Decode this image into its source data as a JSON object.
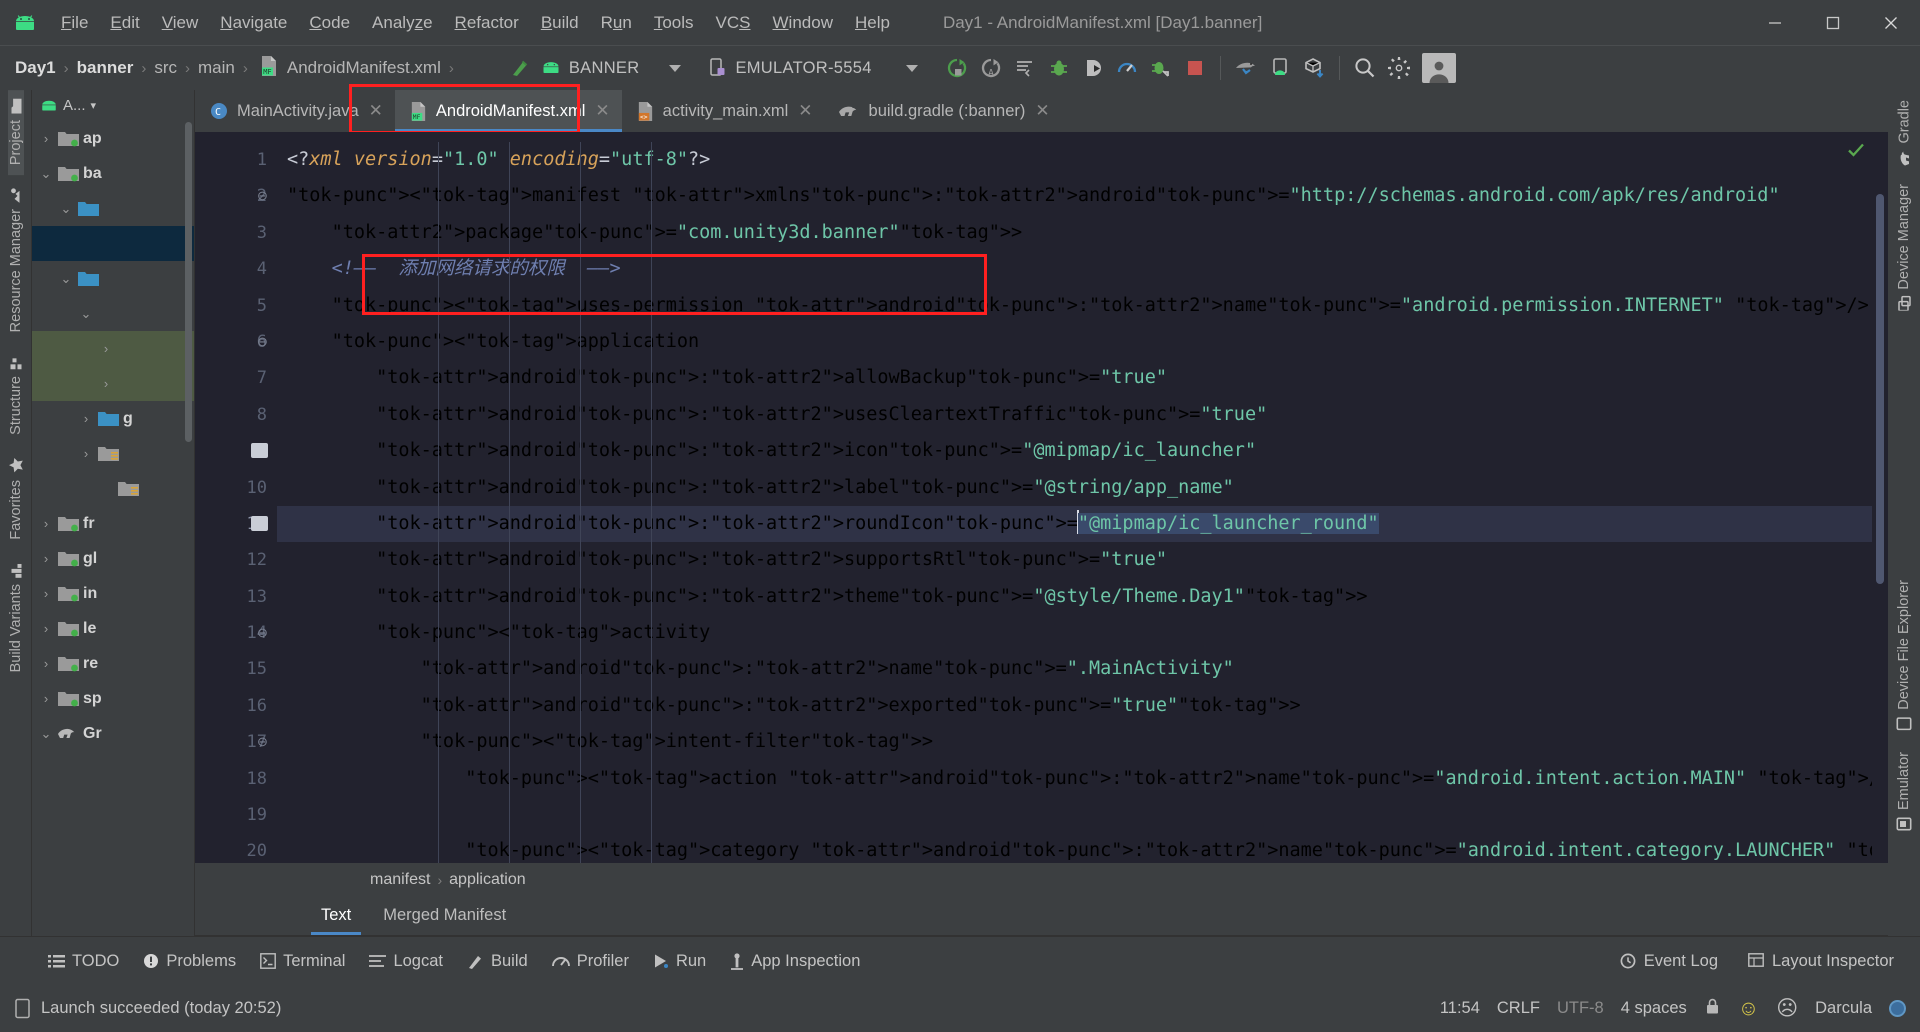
{
  "window": {
    "title": "Day1 - AndroidManifest.xml [Day1.banner]",
    "minimize": "─",
    "maximize": "□",
    "close": "✕"
  },
  "menu": {
    "logo_icon": "android-logo-icon",
    "items": [
      {
        "label": "File",
        "mnemonic": "F"
      },
      {
        "label": "Edit",
        "mnemonic": "E"
      },
      {
        "label": "View",
        "mnemonic": "V"
      },
      {
        "label": "Navigate",
        "mnemonic": "N"
      },
      {
        "label": "Code",
        "mnemonic": "C"
      },
      {
        "label": "Analyze",
        "mnemonic": "z"
      },
      {
        "label": "Refactor",
        "mnemonic": "R"
      },
      {
        "label": "Build",
        "mnemonic": "B"
      },
      {
        "label": "Run",
        "mnemonic": "u"
      },
      {
        "label": "Tools",
        "mnemonic": "T"
      },
      {
        "label": "VCS",
        "mnemonic": "S"
      },
      {
        "label": "Window",
        "mnemonic": "W"
      },
      {
        "label": "Help",
        "mnemonic": "H"
      }
    ]
  },
  "breadcrumb": {
    "items": [
      "Day1",
      "banner",
      "src",
      "main",
      "AndroidManifest.xml"
    ],
    "separator": "›",
    "file_icon": "manifest-file-icon"
  },
  "toolbar": {
    "build_icon": "build-hammer-icon",
    "run_config": {
      "label": "BANNER",
      "icon": "android-config-icon"
    },
    "device": {
      "label": "EMULATOR-5554",
      "icon": "device-phone-icon"
    },
    "actions": [
      {
        "name": "run-button",
        "icon": "run-play-icon"
      },
      {
        "name": "apply-changes-button",
        "icon": "apply-changes-icon"
      },
      {
        "name": "apply-code-changes-button",
        "icon": "apply-code-changes-icon"
      },
      {
        "name": "debug-button",
        "icon": "debug-bug-icon"
      },
      {
        "name": "attach-debugger-button",
        "icon": "attach-debugger-icon"
      },
      {
        "name": "profiler-button",
        "icon": "profiler-icon"
      },
      {
        "name": "run-with-coverage-button",
        "icon": "coverage-icon"
      },
      {
        "name": "stop-button",
        "icon": "stop-square-icon"
      },
      {
        "name": "sync-gradle-button",
        "icon": "gradle-sync-icon"
      },
      {
        "name": "avd-manager-button",
        "icon": "avd-manager-icon"
      },
      {
        "name": "sdk-manager-button",
        "icon": "sdk-manager-icon"
      },
      {
        "name": "search-everywhere-button",
        "icon": "search-icon"
      },
      {
        "name": "settings-button",
        "icon": "gear-icon"
      },
      {
        "name": "account-button",
        "icon": "avatar-icon"
      }
    ]
  },
  "left_strip": [
    {
      "label": "Project",
      "icon": "project-folder-icon",
      "active": true
    },
    {
      "label": "Resource Manager",
      "icon": "resource-manager-icon",
      "active": false
    },
    {
      "label": "Structure",
      "icon": "structure-icon",
      "active": false
    },
    {
      "label": "Favorites",
      "icon": "star-icon",
      "active": false
    },
    {
      "label": "Build Variants",
      "icon": "build-variants-icon",
      "active": false
    }
  ],
  "right_strip": [
    {
      "label": "Gradle",
      "icon": "gradle-elephant-icon"
    },
    {
      "label": "Device Manager",
      "icon": "device-manager-icon"
    },
    {
      "label": "Device File Explorer",
      "icon": "device-file-explorer-icon"
    },
    {
      "label": "Emulator",
      "icon": "emulator-icon"
    }
  ],
  "project_panel": {
    "header": {
      "label": "A...",
      "icon": "android-view-icon",
      "caret": "▾"
    },
    "tree": [
      {
        "arrow": "›",
        "label": "ap",
        "icon": "module-folder-icon",
        "state": "none",
        "indent": 0
      },
      {
        "arrow": "⌄",
        "label": "ba",
        "icon": "module-folder-icon",
        "state": "none",
        "indent": 0
      },
      {
        "arrow": "⌄",
        "label": "",
        "icon": "blue-folder-icon",
        "state": "none",
        "indent": 1
      },
      {
        "arrow": "",
        "label": "",
        "icon": "",
        "state": "blue",
        "indent": 2
      },
      {
        "arrow": "⌄",
        "label": "",
        "icon": "blue-folder-icon",
        "state": "none",
        "indent": 1
      },
      {
        "arrow": "⌄",
        "label": "",
        "icon": "",
        "state": "none",
        "indent": 2
      },
      {
        "arrow": "›",
        "label": "",
        "icon": "",
        "state": "green",
        "indent": 3
      },
      {
        "arrow": "›",
        "label": "",
        "icon": "",
        "state": "green",
        "indent": 3
      },
      {
        "arrow": "›",
        "label": "g",
        "icon": "source-folder-icon",
        "state": "none",
        "indent": 2
      },
      {
        "arrow": "›",
        "label": "",
        "icon": "res-folder-icon",
        "state": "none",
        "indent": 2
      },
      {
        "arrow": "",
        "label": "",
        "icon": "res-folder-icon",
        "state": "none",
        "indent": 3
      },
      {
        "arrow": "›",
        "label": "fr",
        "icon": "module-folder-icon",
        "state": "none",
        "indent": 0
      },
      {
        "arrow": "›",
        "label": "gl",
        "icon": "module-folder-icon",
        "state": "none",
        "indent": 0
      },
      {
        "arrow": "›",
        "label": "in",
        "icon": "module-folder-icon",
        "state": "none",
        "indent": 0
      },
      {
        "arrow": "›",
        "label": "le",
        "icon": "module-folder-icon",
        "state": "none",
        "indent": 0
      },
      {
        "arrow": "›",
        "label": "re",
        "icon": "module-folder-icon",
        "state": "none",
        "indent": 0
      },
      {
        "arrow": "›",
        "label": "sp",
        "icon": "module-folder-icon",
        "state": "none",
        "indent": 0
      },
      {
        "arrow": "⌄",
        "label": "Gr",
        "icon": "gradle-elephant-icon",
        "state": "none",
        "indent": 0
      }
    ]
  },
  "editor_tabs": [
    {
      "label": "MainActivity.java",
      "icon": "java-class-icon",
      "active": false,
      "close": "✕"
    },
    {
      "label": "AndroidManifest.xml",
      "icon": "manifest-file-icon",
      "active": true,
      "close": "✕"
    },
    {
      "label": "activity_main.xml",
      "icon": "layout-xml-icon",
      "active": false,
      "close": "✕"
    },
    {
      "label": "build.gradle (:banner)",
      "icon": "gradle-elephant-icon",
      "active": false,
      "close": "✕"
    }
  ],
  "code": {
    "current_line": 11,
    "lines": [
      {
        "n": 1,
        "mark": false,
        "fold": false
      },
      {
        "n": 2,
        "mark": false,
        "fold": true
      },
      {
        "n": 3,
        "mark": false,
        "fold": false
      },
      {
        "n": 4,
        "mark": false,
        "fold": false
      },
      {
        "n": 5,
        "mark": false,
        "fold": false
      },
      {
        "n": 6,
        "mark": false,
        "fold": true
      },
      {
        "n": 7,
        "mark": false,
        "fold": false
      },
      {
        "n": 8,
        "mark": false,
        "fold": false
      },
      {
        "n": 9,
        "mark": true,
        "fold": false
      },
      {
        "n": 10,
        "mark": false,
        "fold": false
      },
      {
        "n": 11,
        "mark": true,
        "fold": false
      },
      {
        "n": 12,
        "mark": false,
        "fold": false
      },
      {
        "n": 13,
        "mark": false,
        "fold": false
      },
      {
        "n": 14,
        "mark": false,
        "fold": true
      },
      {
        "n": 15,
        "mark": false,
        "fold": false
      },
      {
        "n": 16,
        "mark": false,
        "fold": false
      },
      {
        "n": 17,
        "mark": false,
        "fold": true
      },
      {
        "n": 18,
        "mark": false,
        "fold": false
      },
      {
        "n": 19,
        "mark": false,
        "fold": false
      },
      {
        "n": 20,
        "mark": false,
        "fold": false
      }
    ],
    "text": [
      "<?xml version=\"1.0\" encoding=\"utf-8\"?>",
      "<manifest xmlns:android=\"http://schemas.android.com/apk/res/android\"",
      "    package=\"com.unity3d.banner\">",
      "    <!-- 添加网络请求的权限 -->",
      "    <uses-permission android:name=\"android.permission.INTERNET\" />",
      "    <application",
      "        android:allowBackup=\"true\"",
      "        android:usesCleartextTraffic=\"true\"",
      "        android:icon=\"@mipmap/ic_launcher\"",
      "        android:label=\"@string/app_name\"",
      "        android:roundIcon=\"@mipmap/ic_launcher_round\"",
      "        android:supportsRtl=\"true\"",
      "        android:theme=\"@style/Theme.Day1\">",
      "        <activity",
      "            android:name=\".MainActivity\"",
      "            android:exported=\"true\">",
      "            <intent-filter>",
      "                <action android:name=\"android.intent.action.MAIN\" />",
      "",
      "                <category android:name=\"android.intent.category.LAUNCHER\" />"
    ],
    "breadcrumbs": [
      "manifest",
      "application"
    ],
    "breadcrumb_sep": "›",
    "inspection_status_icon": "checkmark-ok-icon"
  },
  "sub_tabs": [
    {
      "label": "Text",
      "active": true
    },
    {
      "label": "Merged Manifest",
      "active": false
    }
  ],
  "bottom_tools": [
    {
      "label": "TODO",
      "icon": "todo-list-icon"
    },
    {
      "label": "Problems",
      "icon": "problems-icon"
    },
    {
      "label": "Terminal",
      "icon": "terminal-icon"
    },
    {
      "label": "Logcat",
      "icon": "logcat-icon"
    },
    {
      "label": "Build",
      "icon": "build-hammer-icon"
    },
    {
      "label": "Profiler",
      "icon": "profiler-icon"
    },
    {
      "label": "Run",
      "icon": "run-play-icon"
    },
    {
      "label": "App Inspection",
      "icon": "app-inspection-icon"
    }
  ],
  "bottom_tools_right": [
    {
      "label": "Event Log",
      "icon": "event-log-icon"
    },
    {
      "label": "Layout Inspector",
      "icon": "layout-inspector-icon"
    }
  ],
  "status_bar": {
    "message": "Launch succeeded (today 20:52)",
    "message_icon": "device-status-icon",
    "time": "11:54",
    "line_separator": "CRLF",
    "encoding": "UTF-8",
    "indent": "4 spaces",
    "lock_icon": "lock-icon",
    "happy_icon": "☺",
    "sad_icon": "☹",
    "theme": "Darcula"
  },
  "colors": {
    "accent_blue": "#4a88c7",
    "annotation_red": "#ff2020",
    "android_green": "#3ddc84",
    "editor_bg": "#22222e",
    "chrome_bg": "#3c3f41"
  }
}
